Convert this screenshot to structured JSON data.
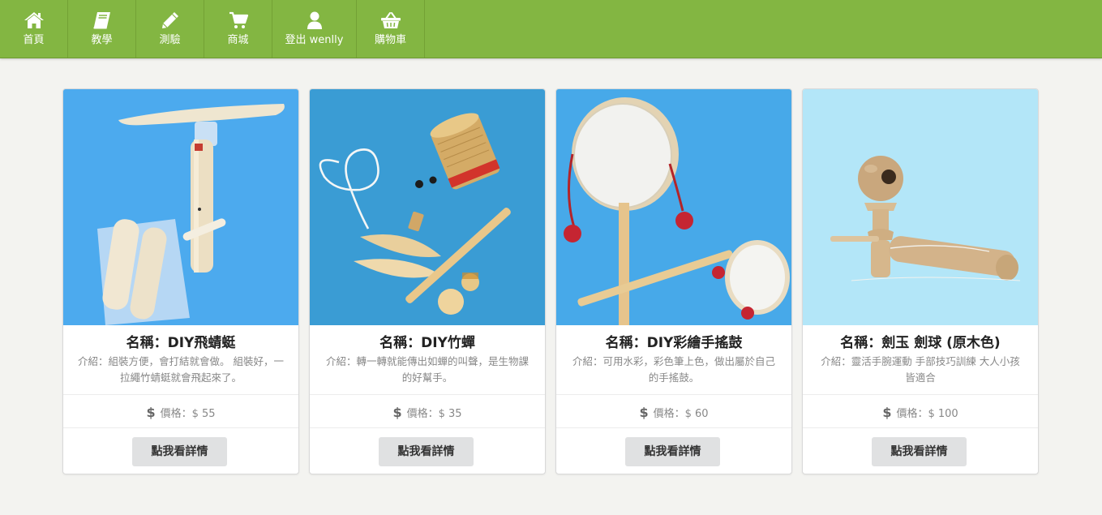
{
  "nav": {
    "items": [
      {
        "label": "首頁",
        "icon": "home-icon"
      },
      {
        "label": "教學",
        "icon": "book-icon"
      },
      {
        "label": "測驗",
        "icon": "pencil-icon"
      },
      {
        "label": "商城",
        "icon": "cart-icon"
      },
      {
        "label": "登出 wenlly",
        "icon": "user-icon"
      },
      {
        "label": "購物車",
        "icon": "basket-icon"
      }
    ]
  },
  "products": [
    {
      "title": "名稱：DIY飛蜻蜓",
      "desc": "介紹：組裝方便，會打結就會做。 組裝好，一拉繩竹蜻蜓就會飛起來了。",
      "price": "價格：$ 55",
      "button": "點我看詳情"
    },
    {
      "title": "名稱：DIY竹蟬",
      "desc": "介紹：轉一轉就能傳出如蟬的叫聲，是生物課的好幫手。",
      "price": "價格：$ 35",
      "button": "點我看詳情"
    },
    {
      "title": "名稱：DIY彩繪手搖鼓",
      "desc": "介紹：可用水彩，彩色筆上色，做出屬於自己的手搖鼓。",
      "price": "價格：$ 60",
      "button": "點我看詳情"
    },
    {
      "title": "名稱：劍玉 劍球 (原木色)",
      "desc": "介紹：靈活手腕運動 手部技巧訓練 大人小孩皆適合",
      "price": "價格：$ 100",
      "button": "點我看詳情"
    }
  ],
  "currency_symbol": "$",
  "colors": {
    "navbar": "#83b642",
    "background": "#f3f3f0",
    "button": "#e0e1e2"
  }
}
